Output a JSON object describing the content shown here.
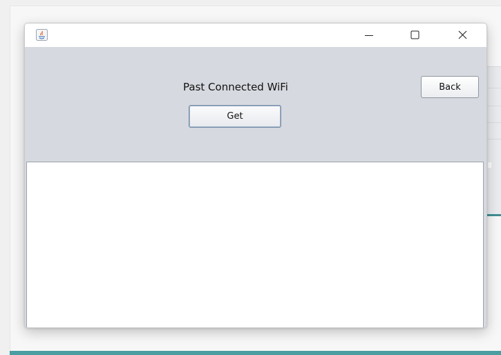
{
  "window": {
    "heading": "Past Connected WiFi",
    "get_label": "Get",
    "back_label": "Back"
  },
  "icons": {
    "app": "java-app-icon",
    "minimize": "minimize-icon",
    "maximize": "maximize-icon",
    "close": "close-icon"
  },
  "colors": {
    "panel_bg": "#d6d9df",
    "accent_teal": "#4a9da0"
  },
  "list": {
    "items": []
  }
}
